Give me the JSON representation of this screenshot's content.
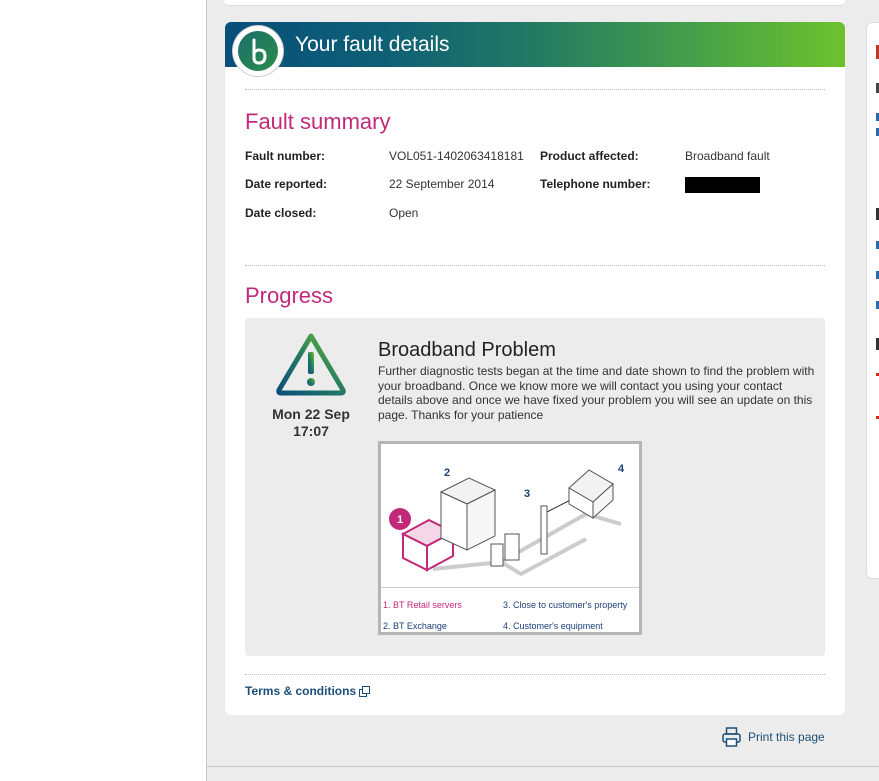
{
  "banner": {
    "title": "Your fault details",
    "logo_icon": "bt-logo-icon"
  },
  "summary": {
    "heading": "Fault summary",
    "fields": [
      {
        "label": "Fault number:",
        "value": "VOL051-1402063418181"
      },
      {
        "label": "Date reported:",
        "value": "22 September 2014"
      },
      {
        "label": "Date closed:",
        "value": "Open"
      },
      {
        "label": "Product affected:",
        "value": "Broadband fault"
      },
      {
        "label": "Telephone number:",
        "value": ""
      }
    ]
  },
  "progress": {
    "heading": "Progress",
    "event": {
      "icon": "warning-triangle-icon",
      "date_line1": "Mon 22 Sep",
      "date_line2": "17:07",
      "title": "Broadband Problem",
      "description": "Further diagnostic tests began at the time and date shown to find the problem with your broadband. Once we know more we will contact you using your contact details above and once we have fixed your problem you will see an update on this page. Thanks for your patience"
    },
    "diagram": {
      "numbers": [
        "1",
        "2",
        "3",
        "4"
      ],
      "legend": [
        "1. BT Retail servers",
        "3. Close to customer's property",
        "2. BT Exchange",
        "4. Customer's equipment"
      ]
    }
  },
  "footer": {
    "terms": "Terms & conditions",
    "terms_icon": "external-link-icon",
    "print": "Print this page",
    "print_icon": "printer-icon"
  },
  "colors": {
    "accent_magenta": "#c2297a",
    "link_blue": "#1a4f78",
    "banner_start": "#084f7a",
    "banner_end": "#6ec12c"
  }
}
